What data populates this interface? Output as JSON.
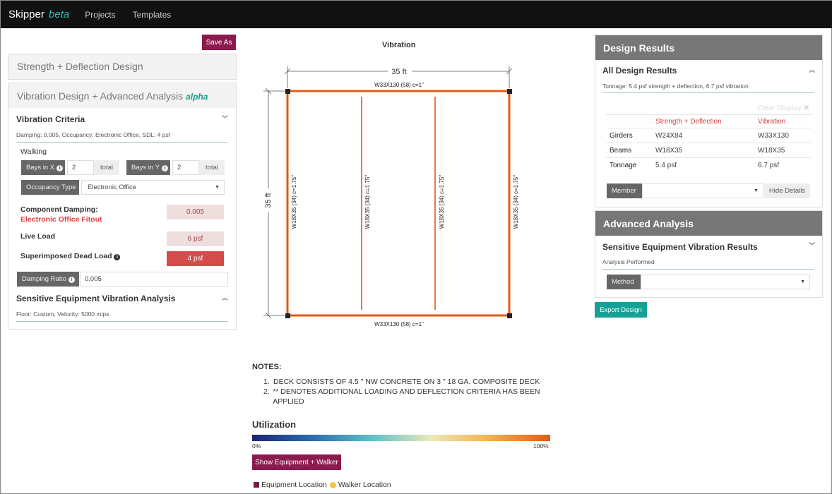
{
  "nav": {
    "brand": "Skipper",
    "brand_tag": "beta",
    "links": [
      "Projects",
      "Templates"
    ]
  },
  "left": {
    "save_as": "Save As",
    "strength_title": "Strength + Deflection Design",
    "vibration_title": "Vibration Design + Advanced Analysis",
    "vibration_tag": "alpha",
    "criteria": {
      "title": "Vibration Criteria",
      "summary": "Damping: 0.005, Occupancy: Electronic Office, SDL: 4 psf",
      "walking": "Walking",
      "bays_x_label": "Bays in X",
      "bays_x_value": "2",
      "bays_y_label": "Bays in Y",
      "bays_y_value": "2",
      "total": "total",
      "occupancy_label": "Occupancy Type",
      "occupancy_value": "Electronic Office",
      "component_damping_label": "Component Damping:",
      "component_damping_source": "Electronic Office Fitout",
      "component_damping_value": "0.005",
      "live_load_label": "Live Load",
      "live_load_value": "6 psf",
      "sdl_label": "Superimposed Dead Load",
      "sdl_value": "4 psf",
      "damping_ratio_label": "Damping Ratio",
      "damping_ratio_value": "0.005"
    },
    "sensitive": {
      "title": "Sensitive Equipment Vibration Analysis",
      "summary": "Floor: Custom, Velocity: 5000 mips"
    }
  },
  "center": {
    "title": "Vibration",
    "dim_x": "35 ft",
    "dim_y": "35 ft",
    "girder_top": "W33X130 (58) c=1\"",
    "girder_bottom": "W33X130 (58) c=1\"",
    "beam_label": "W18X35 (34) c=1.75\"",
    "colors": {
      "member": "#e05a12",
      "column": "#222222"
    },
    "notes_title": "NOTES:",
    "notes": [
      "DECK CONSISTS OF 4.5 \" NW CONCRETE ON 3 \" 18 GA. COMPOSITE DECK",
      "** DENOTES ADDITIONAL LOADING AND DEFLECTION CRITERIA HAS BEEN APPLIED"
    ],
    "utilization_title": "Utilization",
    "util_low": "0%",
    "util_high": "100%",
    "show_button": "Show Equipment + Walker",
    "legend_equipment": "Equipment Location",
    "legend_walker": "Walker Location"
  },
  "right": {
    "design_results_title": "Design Results",
    "all_results_title": "All Design Results",
    "all_results_summary": "Tonnage: 5.4 psf strength + deflection, 6.7 psf vibration",
    "clear_display": "Clear Display",
    "table": {
      "headers": [
        "",
        "Strength + Deflection",
        "Vibration"
      ],
      "rows": [
        [
          "Girders",
          "W24X84",
          "W33X130"
        ],
        [
          "Beams",
          "W18X35",
          "W18X35"
        ],
        [
          "Tonnage",
          "5.4 psf",
          "6.7 psf"
        ]
      ]
    },
    "member_label": "Member",
    "member_value": "",
    "hide_details": "Hide Details",
    "advanced_title": "Advanced Analysis",
    "sev_title": "Sensitive Equipment Vibration Results",
    "sev_summary": "Analysis Performed",
    "method_label": "Method",
    "method_value": "",
    "export": "Export Design"
  }
}
